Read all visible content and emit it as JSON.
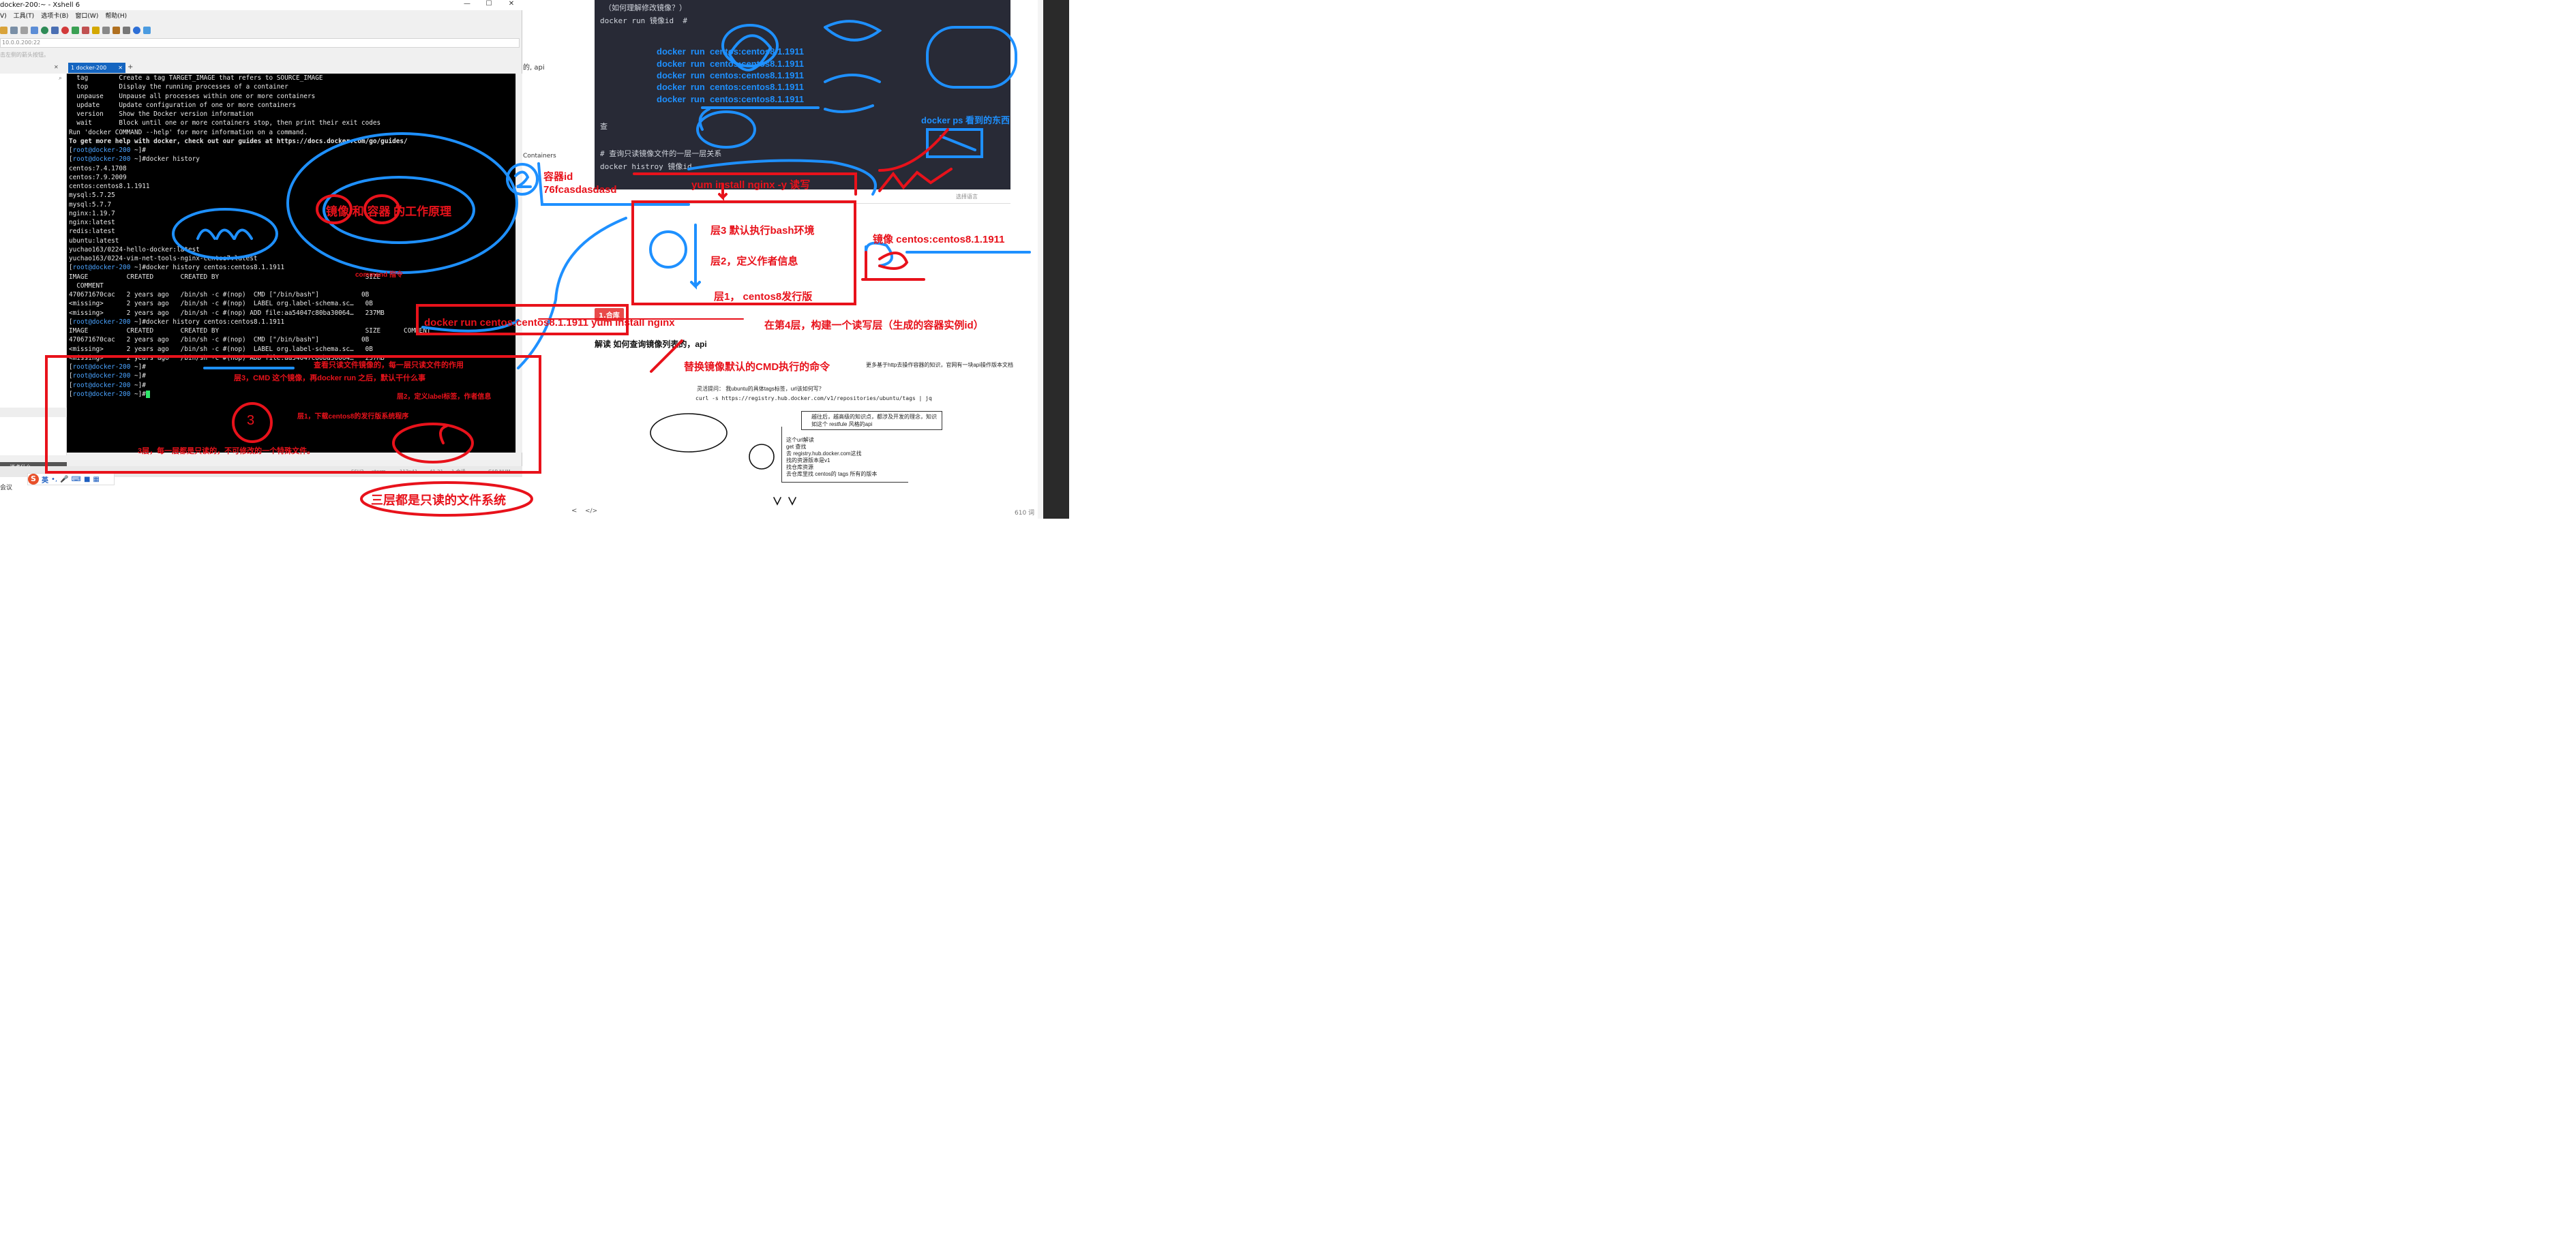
{
  "xshell": {
    "title": "docker-200:~ - Xshell 6",
    "menu": [
      "V)",
      "工具(T)",
      "选项卡(B)",
      "窗口(W)",
      "帮助(H)"
    ],
    "address": "10.0.0.200:22",
    "hint": "击左侧的箭头按钮。",
    "tab_label": "1 docker-200",
    "tab_add": "+",
    "status": {
      "proto": "SSH2",
      "term": "xterm",
      "size": "112x41",
      "pos": "41,21",
      "sessions": "1 会话",
      "caps": "CAP NUM"
    },
    "sidebar_bottom": "说点什么...",
    "sidebar_meeting": "会议"
  },
  "terminal": {
    "lines": [
      "  tag        Create a tag TARGET_IMAGE that refers to SOURCE_IMAGE",
      "  top        Display the running processes of a container",
      "  unpause    Unpause all processes within one or more containers",
      "  update     Update configuration of one or more containers",
      "  version    Show the Docker version information",
      "  wait       Block until one or more containers stop, then print their exit codes",
      "",
      "Run 'docker COMMAND --help' for more information on a command.",
      "",
      "To get more help with docker, check out our guides at https://docs.docker.com/go/guides/",
      "[root@docker-200 ~]#",
      "[root@docker-200 ~]#docker history",
      "centos:7.4.1708",
      "centos:7.9.2009",
      "centos:centos8.1.1911",
      "mysql:5.7.25",
      "mysql:5.7.7",
      "nginx:1.19.7",
      "nginx:latest",
      "redis:latest",
      "ubuntu:latest",
      "yuchao163/0224-hello-docker:latest",
      "yuchao163/0224-vim-net-tools-nginx-centos7:latest",
      "[root@docker-200 ~]#docker history centos:centos8.1.1911",
      "IMAGE          CREATED       CREATED BY                                      SIZE",
      "  COMMENT",
      "470671670cac   2 years ago   /bin/sh -c #(nop)  CMD [\"/bin/bash\"]           0B",
      "",
      "<missing>      2 years ago   /bin/sh -c #(nop)  LABEL org.label-schema.sc…   0B",
      "",
      "<missing>      2 years ago   /bin/sh -c #(nop) ADD file:aa54047c80ba30064…   237MB",
      "",
      "[root@docker-200 ~]#docker history centos:centos8.1.1911",
      "IMAGE          CREATED       CREATED BY                                      SIZE      COMMENT",
      "470671670cac   2 years ago   /bin/sh -c #(nop)  CMD [\"/bin/bash\"]           0B",
      "<missing>      2 years ago   /bin/sh -c #(nop)  LABEL org.label-schema.sc…   0B",
      "<missing>      2 years ago   /bin/sh -c #(nop) ADD file:aa54047c80ba30064…   237MB",
      "[root@docker-200 ~]#",
      "[root@docker-200 ~]#",
      "[root@docker-200 ~]#",
      "[root@docker-200 ~]#"
    ]
  },
  "mid": {
    "frag1": "的, api",
    "frag2": "Containers"
  },
  "notes": {
    "code_lines": [
      "（如何理解修改镜像？）",
      "docker run 镜像id  #"
    ],
    "cyan_lines": [
      "docker  run  centos:centos8.1.1911",
      "docker  run  centos:centos8.1.1911",
      "docker  run  centos:centos8.1.1911",
      "docker  run  centos:centos8.1.1911",
      "docker  run  centos:centos8.1.1911"
    ],
    "cha": "查",
    "comment": "# 查询只读镜像文件的一层一层关系",
    "history_cmd": "docker histroy 镜像id",
    "lang": "选择语言",
    "badge": "1.合库",
    "heading": "解读 如何查询镜像列表的，api",
    "note_right": "更多基于http去操作容器的知识，官网有一块api操作版本文档",
    "inspire": "灵活提问：   我ubuntu的具体tags标签，url该如何写？",
    "curl": "curl -s https://registry.hub.docker.com/v1/repositories/ubuntu/tags    |   jq",
    "box_lines": [
      "越往后，越高级的知识点，都涉及开发的理念，知识",
      "如这个   restfule 风格的api"
    ],
    "list_lines": [
      "这个url解读",
      "get  查找",
      "去 registry.hub.docker.com这找",
      "找的资源版本是v1",
      "找仓库资源",
      "去仓库里找   centos的 tags   所有的版本"
    ],
    "wordcount": "610 词",
    "footer_left": "<",
    "footer_code": "</>"
  },
  "annotations": {
    "red": {
      "work_principle": "镜像 和 容器 的工作原理",
      "command": "command 指令",
      "container_id": "容器id",
      "container_hash": "76fcasdasdasd",
      "yum_rw": "yum install  nginx -y  读写",
      "layer3": "层3  默认执行bash环境",
      "layer2": "层2，定义作者信息",
      "layer1": "层1，  centos8发行版",
      "image_label": "镜像 centos:centos8.1.1911",
      "docker_run": "docker run  centos:centos8.1.1911  yum install nginx",
      "fourth_layer": "在第4层，构建一个读写层（生成的容器实例id）",
      "replace_cmd": "替换镜像默认的CMD执行的命令",
      "view_layers": "查看只读文件镜像的，每一层只读文件的作用",
      "layer3_cmd": "层3，CMD 这个镜像，再docker run 之后，默认干什么事",
      "layer2_label": "层2，定义label标签，作者信息",
      "layer1_dl": "层1，下载centos8的发行版系统程序",
      "three_layers_ro": "3层，每一层都是只读的，不可修改的一个特殊文件。",
      "three_fs": "三层都是只读的文件系统",
      "num_three": "3"
    },
    "blue": {
      "ps_note": "docker ps 看到的东西"
    }
  },
  "colors": {
    "accent_red": "#e8121b",
    "accent_blue": "#1e90ff",
    "terminal_bg": "#000000",
    "prompt_blue": "#4aa3ff",
    "code_bg": "#282a36"
  }
}
